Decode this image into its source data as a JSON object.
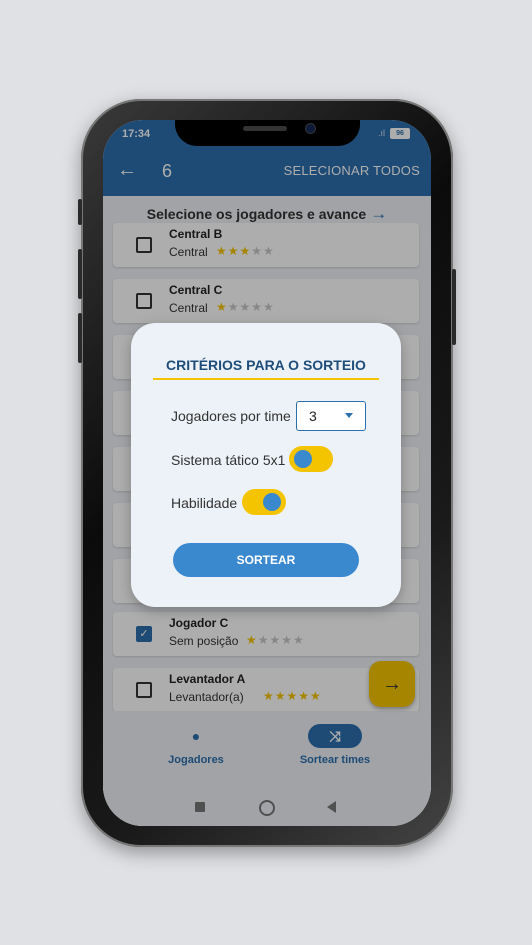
{
  "status": {
    "time": "17:34",
    "battery": "96"
  },
  "appbar": {
    "back_glyph": "←",
    "count": "6",
    "select_all": "SELECIONAR TODOS"
  },
  "hint": {
    "text": "Selecione os jogadores e avance",
    "arrow": "→"
  },
  "players": [
    {
      "name": "Central B",
      "position": "Central",
      "rating": 3,
      "checked": false
    },
    {
      "name": "Central C",
      "position": "Central",
      "rating": 1,
      "checked": false
    },
    {
      "name": "Jogador C",
      "position": "Sem posição",
      "rating": 1,
      "checked": true
    },
    {
      "name": "Levantador A",
      "position": "Levantador(a)",
      "rating": 5,
      "checked": false
    }
  ],
  "dialog": {
    "title": "CRITÉRIOS PARA O SORTEIO",
    "players_per_team_label": "Jogadores por time",
    "players_per_team_value": "3",
    "tactical_label": "Sistema tático 5x1",
    "tactical_on": false,
    "skill_label": "Habilidade",
    "skill_on": true,
    "button": "SORTEAR"
  },
  "fab": {
    "icon": "arrow-right-icon",
    "glyph": "→"
  },
  "bottom_nav": [
    {
      "label": "Jogadores",
      "icon": "person-icon",
      "glyph": "●",
      "active": false
    },
    {
      "label": "Sortear times",
      "icon": "shuffle-icon",
      "glyph": "⤨",
      "active": true
    }
  ],
  "colors": {
    "primary": "#2c6fad",
    "accent": "#f5c400",
    "button": "#3a89cf"
  }
}
